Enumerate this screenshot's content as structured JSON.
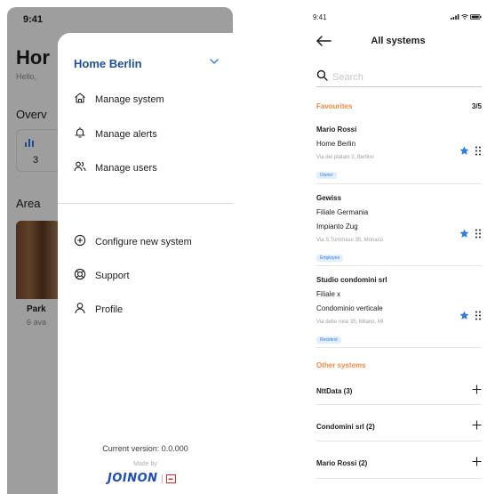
{
  "left": {
    "status_time": "9:41",
    "background": {
      "title": "Hor",
      "hello": "Hello,",
      "overview": "Overv",
      "card_value": "3",
      "area": "Area",
      "park_title": "Park",
      "park_sub": "6 ava"
    },
    "menu": {
      "system_name": "Home Berlin",
      "items_top": [
        {
          "label": "Manage system",
          "icon": "home-icon"
        },
        {
          "label": "Manage alerts",
          "icon": "bell-icon"
        },
        {
          "label": "Manage users",
          "icon": "users-icon"
        }
      ],
      "items_bottom": [
        {
          "label": "Configure new system",
          "icon": "plus-circle-icon"
        },
        {
          "label": "Support",
          "icon": "lifebuoy-icon"
        },
        {
          "label": "Profile",
          "icon": "user-icon"
        }
      ],
      "version": "Current version: 0.0.000",
      "made_by": "Made by",
      "brand": "JOINON"
    }
  },
  "right": {
    "status_time": "9:41",
    "title": "All systems",
    "search_placeholder": "Search",
    "favourites_label": "Favourites",
    "favourites_count": "3/5",
    "favourites": [
      {
        "owner": "Mario Rossi",
        "lines": [
          "Home Berlin"
        ],
        "address": "Via dei platani 2, Berlino",
        "role": "Owner"
      },
      {
        "owner": "Gewiss",
        "lines": [
          "Filiale Germania",
          "Impianto Zug"
        ],
        "address": "Via S.Tommaso 35, Monaco",
        "role": "Employee"
      },
      {
        "owner": "Studio condomini srl",
        "lines": [
          "Filiale x",
          "Condominio verticale"
        ],
        "address": "Via delle rose 35, Milano, MI",
        "role": "Resident"
      }
    ],
    "other_label": "Other systems",
    "other_systems": [
      "NttData (3)",
      "Condomini srl (2)",
      "Mario Rossi (2)"
    ],
    "colors": {
      "accent": "#2f7fe0",
      "section": "#f08a45",
      "brand": "#1e4fb5"
    }
  }
}
